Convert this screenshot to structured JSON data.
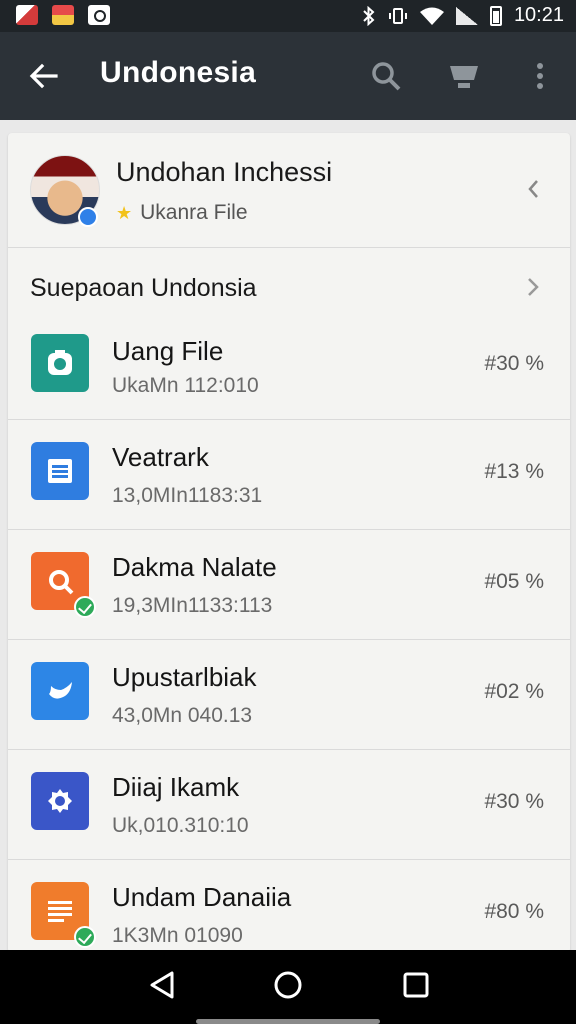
{
  "status_bar": {
    "time": "10:21",
    "icons": [
      "bluetooth-icon",
      "vibrate-icon",
      "wifi-icon",
      "signal-icon",
      "battery-icon"
    ]
  },
  "app_bar": {
    "title": "Undonesia",
    "back_icon": "arrow-left-icon",
    "actions": [
      "search-icon",
      "cart-icon",
      "more-vert-icon"
    ]
  },
  "profile": {
    "name": "Undohan Inchessi",
    "subtitle": "Ukanra File",
    "star_icon": "star-icon"
  },
  "section": {
    "label": "Suepaoan Undonsia"
  },
  "items": [
    {
      "title": "Uang File",
      "subtitle": "UkaMn 112:010",
      "percent": "#30 %",
      "icon_color": "#1f9a8a",
      "icon": "camera-icon",
      "checked": false
    },
    {
      "title": "Veatrark",
      "subtitle": "13,0MIn1183:31",
      "percent": "#13 %",
      "icon_color": "#2f7de0",
      "icon": "document-icon",
      "checked": false
    },
    {
      "title": "Dakma Nalate",
      "subtitle": "19,3MIn1133:113",
      "percent": "#05 %",
      "icon_color": "#f06a2e",
      "icon": "search-icon",
      "checked": true
    },
    {
      "title": "Upustarlbiak",
      "subtitle": "43,0Mn 040.13",
      "percent": "#02 %",
      "icon_color": "#2d86e6",
      "icon": "bird-icon",
      "checked": false
    },
    {
      "title": "Diiaj Ikamk",
      "subtitle": "Uk,010.310:10",
      "percent": "#30 %",
      "icon_color": "#3a56c8",
      "icon": "gear-icon",
      "checked": false
    },
    {
      "title": "Undam Danaiia",
      "subtitle": "1K3Mn 01090",
      "percent": "#80 %",
      "icon_color": "#f07c2c",
      "icon": "list-icon",
      "checked": true
    }
  ],
  "nav_bar": {
    "buttons": [
      "back-triangle-icon",
      "home-circle-icon",
      "recents-square-icon"
    ]
  }
}
